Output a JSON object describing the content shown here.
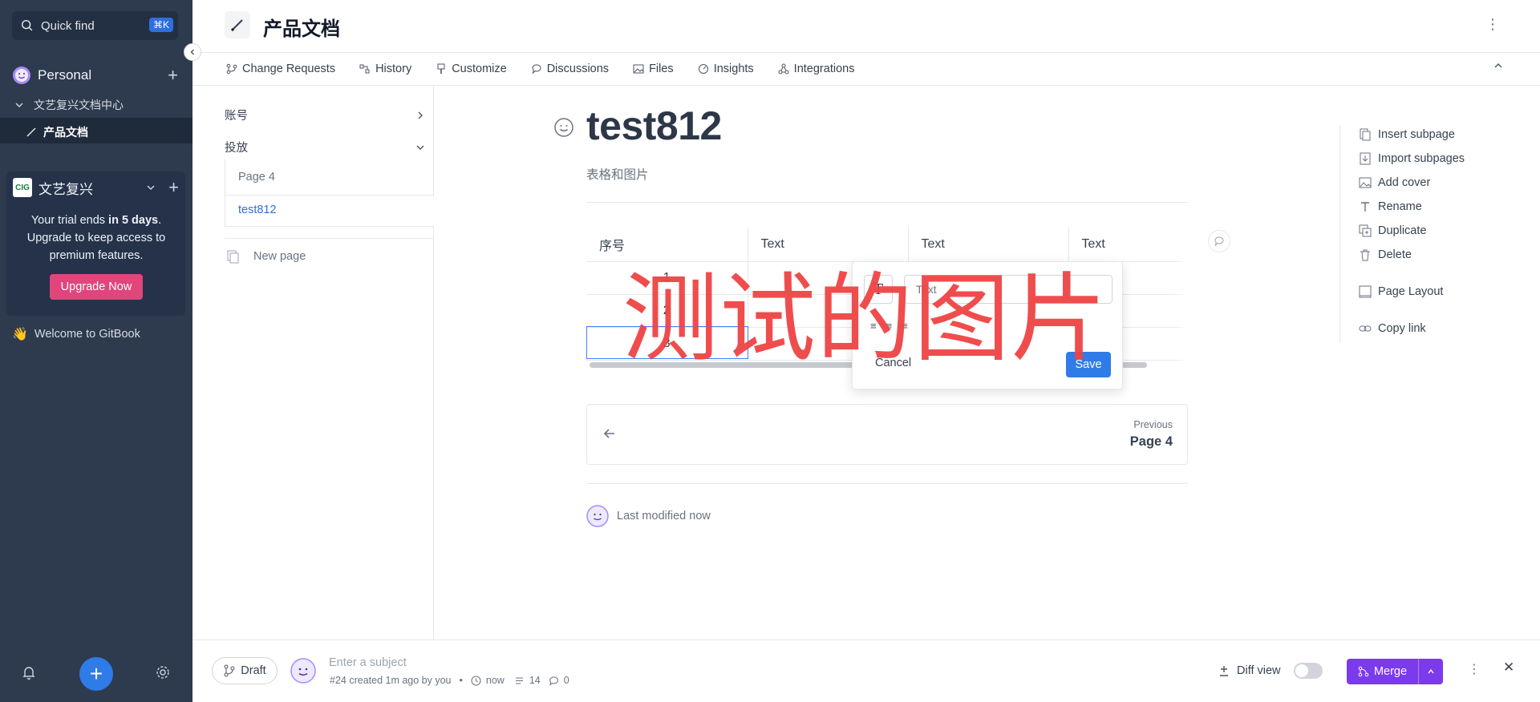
{
  "sidebar": {
    "quick_find": "Quick find",
    "shortcut": "⌘K",
    "personal_label": "Personal",
    "items": [
      {
        "label": "文艺复兴文档中心"
      },
      {
        "label": "产品文档"
      }
    ],
    "org_name": "文艺复兴",
    "trial": {
      "line1_prefix": "Your trial ends ",
      "line1_bold": "in 5 days",
      "line1_suffix": ".",
      "line2": "Upgrade to keep access to premium features."
    },
    "upgrade_button": "Upgrade Now",
    "welcome": "Welcome to GitBook",
    "welcome_emoji": "👋"
  },
  "header": {
    "title": "产品文档"
  },
  "tabs": [
    {
      "label": "Change Requests"
    },
    {
      "label": "History"
    },
    {
      "label": "Customize"
    },
    {
      "label": "Discussions"
    },
    {
      "label": "Files"
    },
    {
      "label": "Insights"
    },
    {
      "label": "Integrations"
    }
  ],
  "tree": {
    "group1": "账号",
    "group2": "投放",
    "children": [
      "Page 4",
      "test812"
    ],
    "new_page": "New page"
  },
  "doc": {
    "title": "test812",
    "description": "表格和图片",
    "table": {
      "headers": [
        "序号",
        "Text",
        "Text",
        "Text"
      ],
      "rows": [
        [
          "1",
          "",
          "",
          ""
        ],
        [
          "2",
          "",
          "",
          ""
        ],
        [
          "3",
          "",
          "",
          ""
        ]
      ]
    },
    "popup": {
      "input_placeholder": "Text",
      "cancel": "Cancel",
      "save": "Save"
    },
    "watermark": "测试的图片",
    "prev_label": "Previous",
    "prev_title": "Page 4",
    "last_modified": "Last modified now"
  },
  "actions": [
    {
      "label": "Insert subpage"
    },
    {
      "label": "Import subpages"
    },
    {
      "label": "Add cover"
    },
    {
      "label": "Rename"
    },
    {
      "label": "Duplicate"
    },
    {
      "label": "Delete"
    },
    {
      "label": "Page Layout"
    },
    {
      "label": "Copy link"
    }
  ],
  "change_request": {
    "status": "Draft",
    "subject_placeholder": "Enter a subject",
    "meta": "#24 created 1m ago by you",
    "time": "now",
    "edits": "14",
    "comments": "0",
    "diff_view": "Diff view",
    "merge": "Merge"
  },
  "colors": {
    "sidebar_bg": "#2e3a4e",
    "accent_blue": "#2f7be8",
    "upgrade_pink": "#e0457b",
    "merge_purple": "#7c3aed",
    "watermark_red": "#ef4444"
  }
}
